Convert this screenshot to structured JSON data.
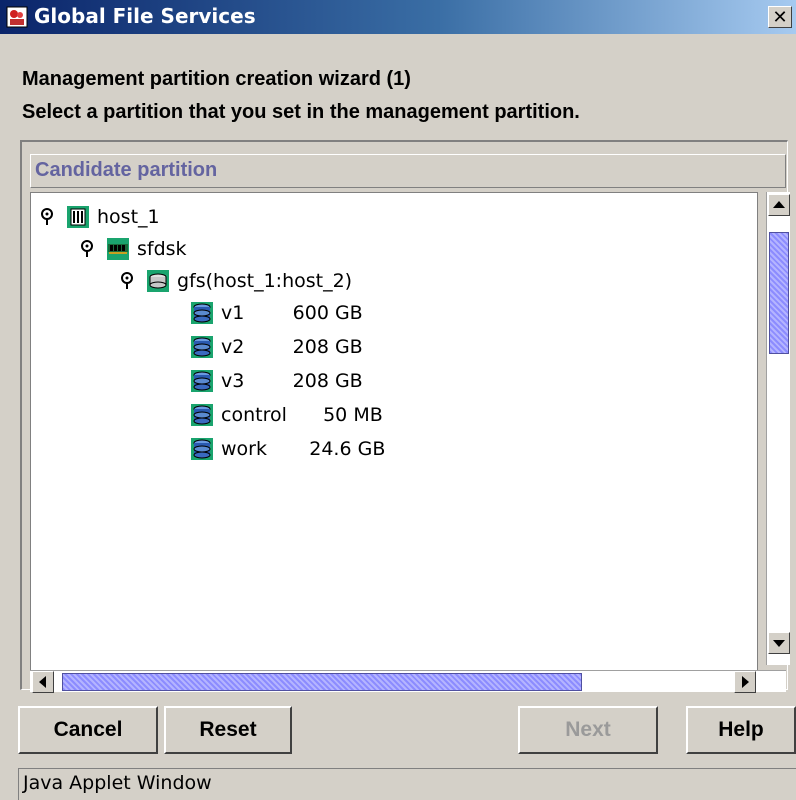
{
  "window": {
    "title": "Global File Services",
    "close_glyph": "✕"
  },
  "wizard": {
    "heading": "Management partition creation wizard (1)",
    "instruction": "Select a partition that you set in the management partition."
  },
  "panel": {
    "header": "Candidate partition"
  },
  "tree": [
    {
      "label": "host_1",
      "icon": "host-icon",
      "pin": true
    },
    {
      "label": "sfdsk",
      "icon": "memory-icon",
      "pin": true
    },
    {
      "label": "gfs(host_1:host_2)",
      "icon": "disk-class-icon",
      "pin": true
    },
    {
      "label": "v1        600 GB",
      "icon": "volume-icon",
      "pin": false
    },
    {
      "label": "v2        208 GB",
      "icon": "volume-icon",
      "pin": false
    },
    {
      "label": "v3        208 GB",
      "icon": "volume-icon",
      "pin": false
    },
    {
      "label": "control      50 MB",
      "icon": "volume-icon",
      "pin": false
    },
    {
      "label": "work       24.6 GB",
      "icon": "volume-icon",
      "pin": false
    }
  ],
  "buttons": {
    "cancel": "Cancel",
    "reset": "Reset",
    "next": "Next",
    "help": "Help"
  },
  "status": {
    "text": "Java Applet Window"
  },
  "colors": {
    "title_start": "#0a246a",
    "title_end": "#a6caf0",
    "icon_bg": "#1aa46e",
    "header_text": "#6464a0",
    "scroll_thumb": "#8c8cff"
  }
}
